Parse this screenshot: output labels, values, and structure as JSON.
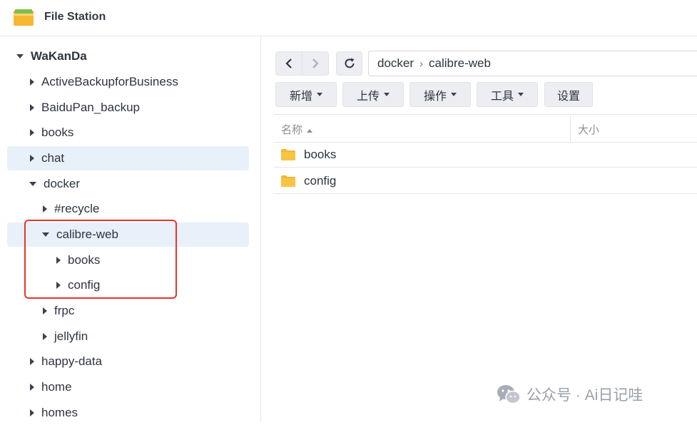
{
  "app": {
    "title": "File Station",
    "icon": "file-station-folder-icon"
  },
  "sidebar": {
    "items": [
      {
        "label": "WaKanDa",
        "expanded": true,
        "root": true,
        "selected": false
      },
      {
        "label": "ActiveBackupforBusiness",
        "expanded": false,
        "selected": false
      },
      {
        "label": "BaiduPan_backup",
        "expanded": false,
        "selected": false
      },
      {
        "label": "books",
        "expanded": false,
        "selected": false
      },
      {
        "label": "chat",
        "expanded": false,
        "selected": true
      },
      {
        "label": "docker",
        "expanded": true,
        "selected": false
      },
      {
        "label": "#recycle",
        "expanded": false,
        "selected": false
      },
      {
        "label": "calibre-web",
        "expanded": true,
        "selected": true
      },
      {
        "label": "books",
        "expanded": false,
        "selected": false
      },
      {
        "label": "config",
        "expanded": false,
        "selected": false
      },
      {
        "label": "frpc",
        "expanded": false,
        "selected": false
      },
      {
        "label": "jellyfin",
        "expanded": false,
        "selected": false
      },
      {
        "label": "happy-data",
        "expanded": false,
        "selected": false
      },
      {
        "label": "home",
        "expanded": false,
        "selected": false
      },
      {
        "label": "homes",
        "expanded": false,
        "selected": false
      }
    ]
  },
  "nav": {
    "back_icon": "chevron-left-icon",
    "forward_icon": "chevron-right-icon",
    "refresh_icon": "refresh-icon",
    "path": [
      "docker",
      "calibre-web"
    ]
  },
  "toolbar": {
    "create_label": "新增",
    "upload_label": "上传",
    "action_label": "操作",
    "tools_label": "工具",
    "settings_label": "设置"
  },
  "table": {
    "columns": {
      "name": "名称",
      "size": "大小"
    },
    "rows": [
      {
        "name": "books",
        "icon": "folder-icon"
      },
      {
        "name": "config",
        "icon": "folder-icon"
      }
    ]
  },
  "watermark": {
    "text": "公众号 · Ai日记哇",
    "icon": "wechat-icon"
  },
  "colors": {
    "accent_highlight": "#e8352b",
    "selected_bg": "#e8f0fa",
    "folder": "#f5b731",
    "button_bg": "#eceef2"
  }
}
